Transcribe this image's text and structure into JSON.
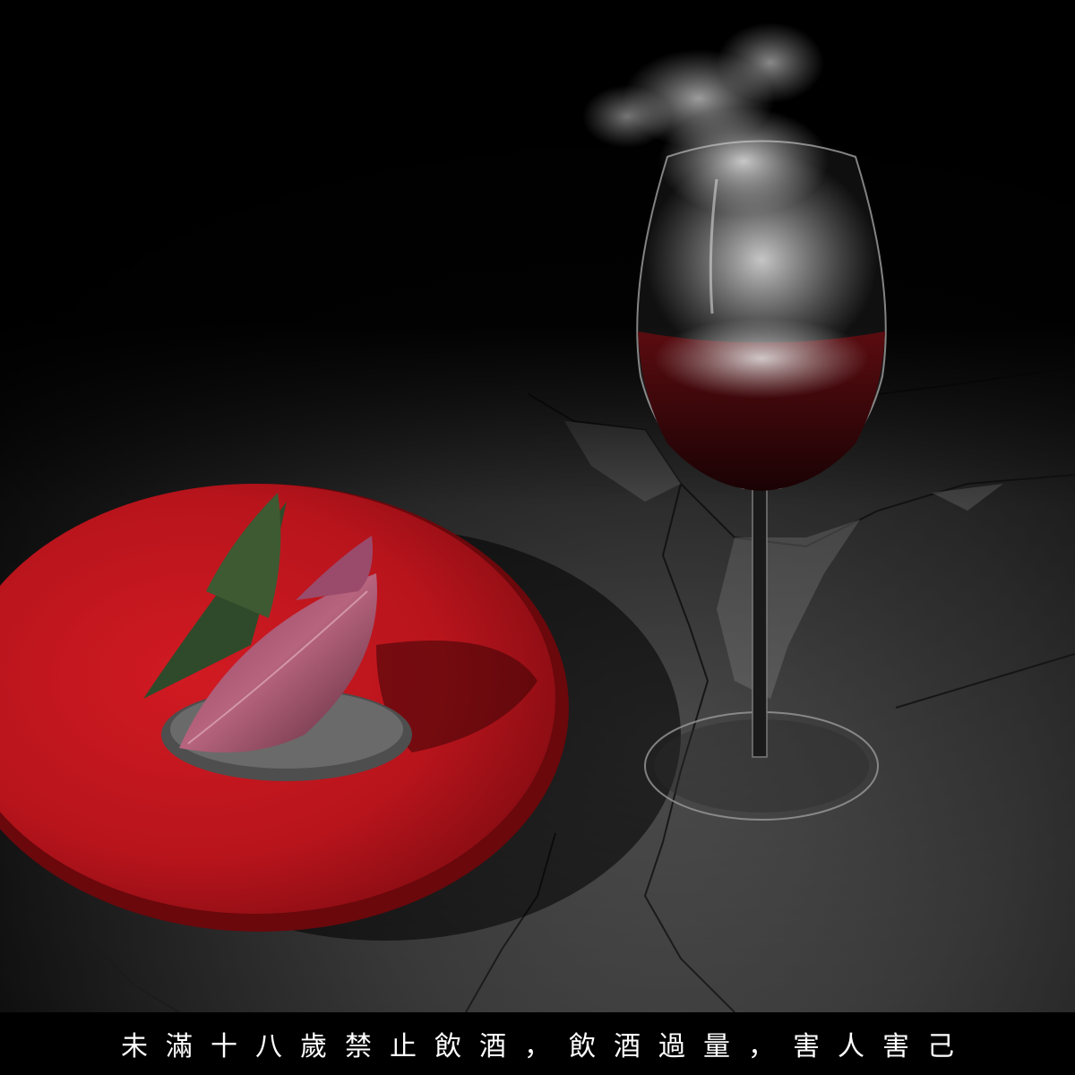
{
  "warning": {
    "text": "未滿十八歲禁止飲酒，飲酒過量，害人害己"
  },
  "scene": {
    "background_color": "#000000",
    "plate_color": "#b8141c",
    "floor_color": "#3a3a3a",
    "wine_color": "#3a0608"
  }
}
